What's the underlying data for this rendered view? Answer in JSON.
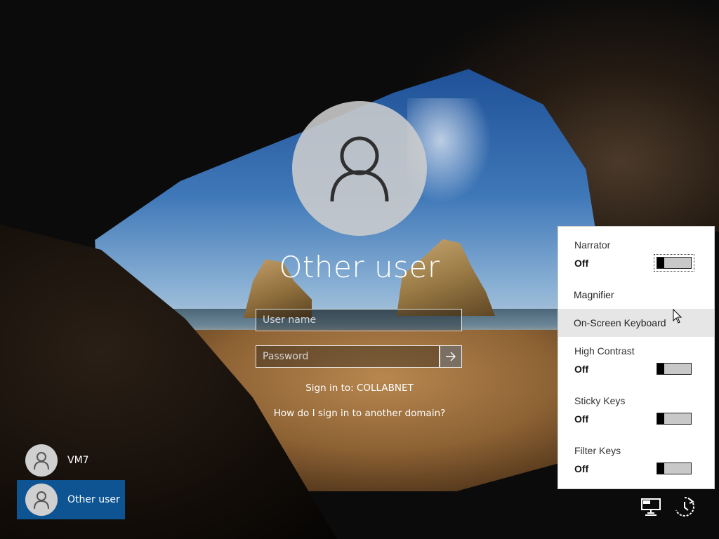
{
  "login": {
    "user_title": "Other user",
    "username_placeholder": "User name",
    "password_placeholder": "Password",
    "signin_to": "Sign in to: COLLABNET",
    "help_link": "How do I sign in to another domain?"
  },
  "users": [
    {
      "name": "VM7",
      "selected": false
    },
    {
      "name": "Other user",
      "selected": true
    }
  ],
  "ease_of_access": {
    "narrator": {
      "label": "Narrator",
      "state": "Off"
    },
    "magnifier": {
      "label": "Magnifier"
    },
    "osk": {
      "label": "On-Screen Keyboard"
    },
    "high_contrast": {
      "label": "High Contrast",
      "state": "Off"
    },
    "sticky_keys": {
      "label": "Sticky Keys",
      "state": "Off"
    },
    "filter_keys": {
      "label": "Filter Keys",
      "state": "Off"
    }
  },
  "tray": {
    "network_icon": "network-icon",
    "ease_icon": "ease-of-access-icon"
  },
  "colors": {
    "selected_user_bg": "#0e5493",
    "panel_bg": "#ffffff",
    "hover_row_bg": "#e6e6e6"
  }
}
